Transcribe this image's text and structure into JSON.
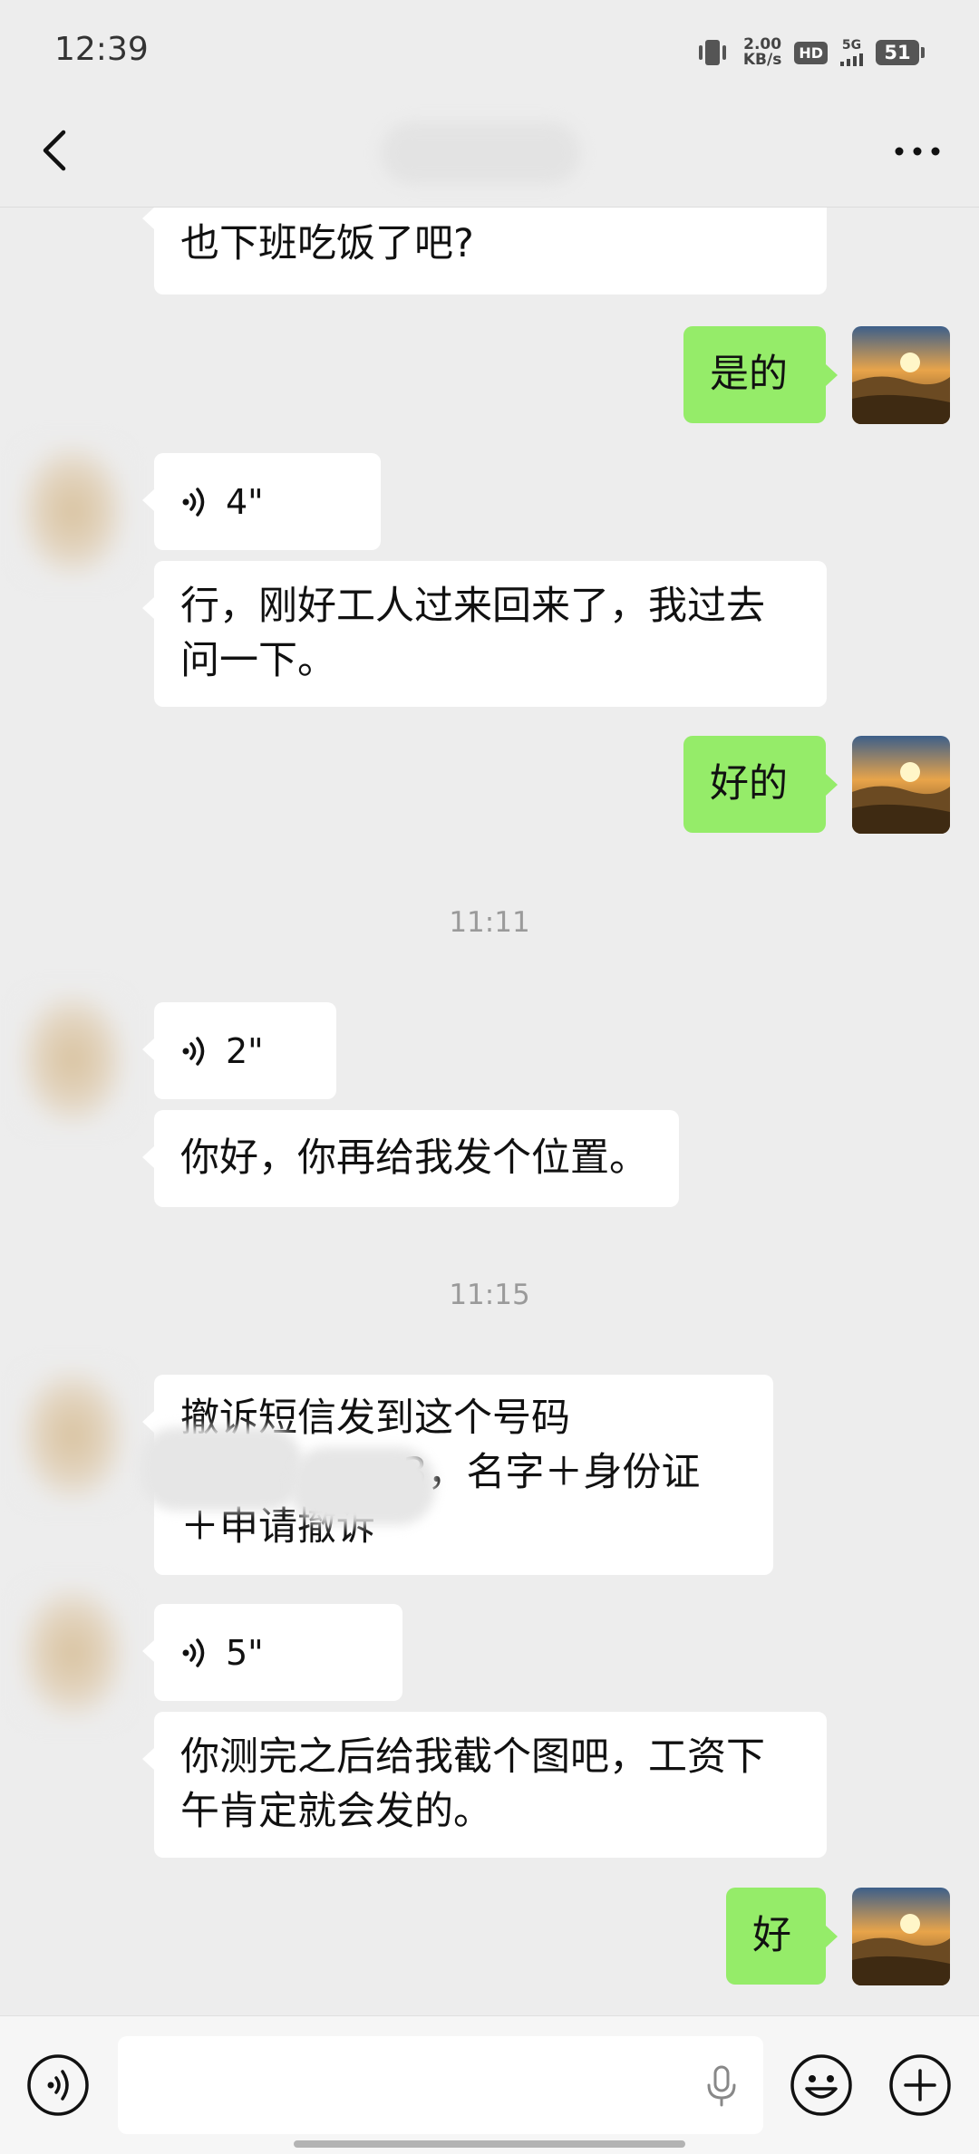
{
  "status_bar": {
    "time": "12:39",
    "net_speed_value": "2.00",
    "net_speed_unit": "KB/s",
    "hd_badge": "HD",
    "network_type": "5G",
    "battery": "51"
  },
  "nav": {
    "title": ""
  },
  "messages": {
    "m1": "也下班吃饭了吧?",
    "m2": "是的",
    "m3": "4\"",
    "m4": "行，刚好工人过来回来了，我过去\n问一下。",
    "m5": "好的",
    "t1": "11:11",
    "m6": "2\"",
    "m7": "你好，你再给我发个位置。",
    "t2": "11:15",
    "m8_line1": "撤诉短信发到这个号码",
    "m8_line2": "3，名字＋身份证",
    "m8_line3": "＋申请撤诉",
    "m9": "5\"",
    "m10": "你测完之后给我截个图吧，工资下\n午肯定就会发的。",
    "m11": "好"
  },
  "colors": {
    "background": "#ededed",
    "outgoing_bubble": "#95ec69",
    "incoming_bubble": "#ffffff"
  },
  "icons": [
    "back-icon",
    "more-icon",
    "voice-wave-icon",
    "voice-input-icon",
    "mic-icon",
    "emoji-icon",
    "plus-icon"
  ]
}
